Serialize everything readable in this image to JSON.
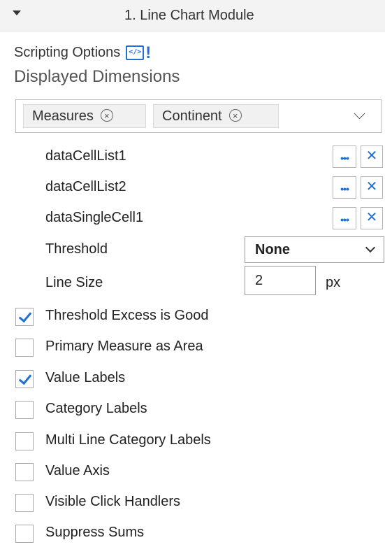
{
  "header": {
    "title": "1. Line Chart Module"
  },
  "scripting": {
    "label": "Scripting Options",
    "icon_text": "</>",
    "icon_bang": "!"
  },
  "dimensions": {
    "title": "Displayed Dimensions",
    "chips": [
      {
        "label": "Measures"
      },
      {
        "label": "Continent"
      }
    ],
    "remove_glyph": "×"
  },
  "cells": [
    {
      "label": "dataCellList1",
      "more": "•••",
      "remove": "✕"
    },
    {
      "label": "dataCellList2",
      "more": "•••",
      "remove": "✕"
    },
    {
      "label": "dataSingleCell1",
      "more": "•••",
      "remove": "✕"
    }
  ],
  "threshold": {
    "label": "Threshold",
    "value": "None"
  },
  "line_size": {
    "label": "Line Size",
    "value": "2",
    "unit": "px"
  },
  "options": [
    {
      "label": "Threshold Excess is Good",
      "checked": true
    },
    {
      "label": "Primary Measure as Area",
      "checked": false
    },
    {
      "label": "Value Labels",
      "checked": true
    },
    {
      "label": "Category Labels",
      "checked": false
    },
    {
      "label": "Multi Line Category Labels",
      "checked": false
    },
    {
      "label": "Value Axis",
      "checked": false
    },
    {
      "label": "Visible Click Handlers",
      "checked": false
    },
    {
      "label": "Suppress Sums",
      "checked": false
    }
  ],
  "colors": {
    "accent": "#1f6fd6",
    "header_bg": "#f3f3f3",
    "chip_bg": "#f1f1f1"
  }
}
